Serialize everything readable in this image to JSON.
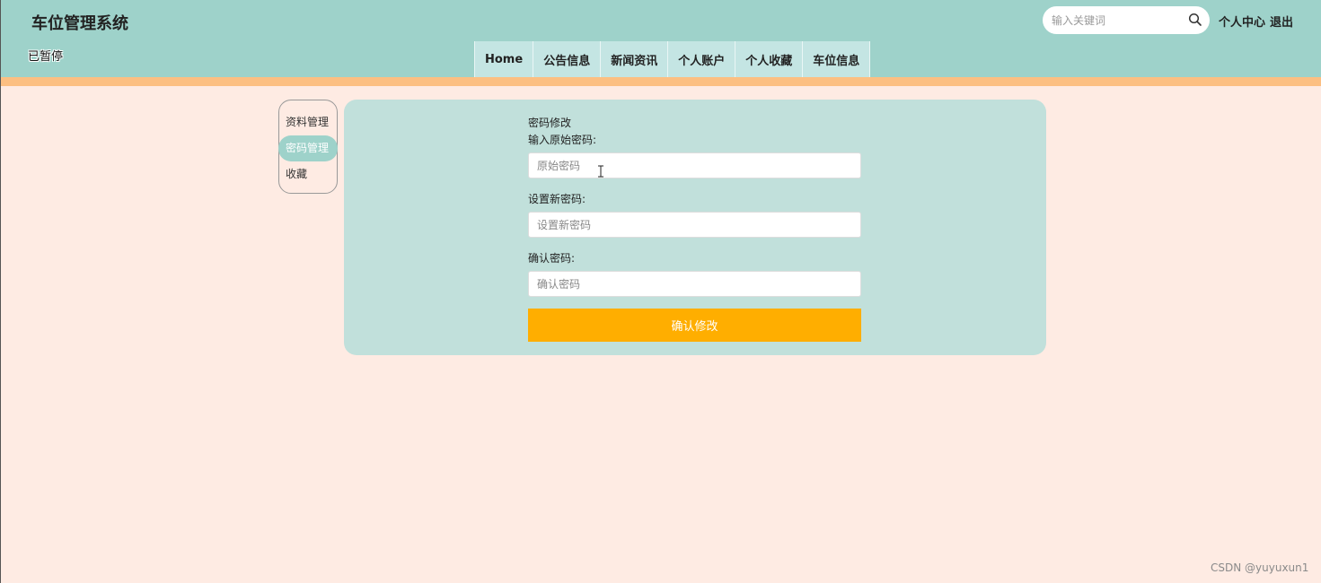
{
  "header": {
    "site_title": "车位管理系统",
    "paused_label": "已暂停",
    "search_placeholder": "输入关键词",
    "search_icon": "search-icon",
    "user_center": "个人中心",
    "logout": "退出",
    "bg_color": "#9ed2ca",
    "strip_color": "#fcbf82"
  },
  "nav": {
    "items": [
      "Home",
      "公告信息",
      "新闻资讯",
      "个人账户",
      "个人收藏",
      "车位信息"
    ]
  },
  "sidebar": {
    "items": [
      {
        "label": "资料管理",
        "active": false
      },
      {
        "label": "密码管理",
        "active": true
      },
      {
        "label": "收藏",
        "active": false
      }
    ]
  },
  "form": {
    "title": "密码修改",
    "old_label": "输入原始密码:",
    "old_placeholder": "原始密码",
    "new_label": "设置新密码:",
    "new_placeholder": "设置新密码",
    "confirm_label": "确认密码:",
    "confirm_placeholder": "确认密码",
    "submit_label": "确认修改",
    "submit_color": "#ffae00"
  },
  "watermark": "CSDN @yuyuxun1"
}
